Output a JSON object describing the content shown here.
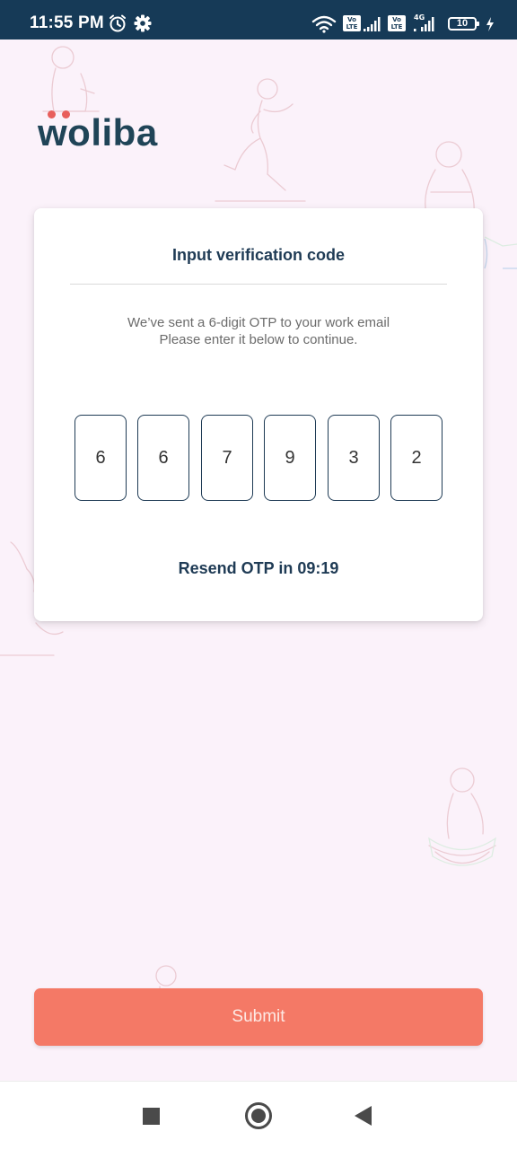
{
  "status_bar": {
    "time": "11:55 PM",
    "network_badge_1": "Vo LTE",
    "network_badge_2": "Vo LTE",
    "network_type": "4G",
    "battery": "10"
  },
  "brand": {
    "logo_text": "woliba"
  },
  "card": {
    "title": "Input verification code",
    "description_line1": "We’ve sent a 6-digit OTP to your work email",
    "description_line2": "Please enter it below to continue.",
    "otp_digits": [
      "6",
      "6",
      "7",
      "9",
      "3",
      "2"
    ],
    "resend_text": "Resend OTP in 09:19"
  },
  "submit_label": "Submit",
  "colors": {
    "status_bar": "#163a57",
    "background": "#fbf2fa",
    "primary_text": "#1f3b55",
    "accent": "#f47966",
    "logo_dot": "#e85f5c"
  }
}
